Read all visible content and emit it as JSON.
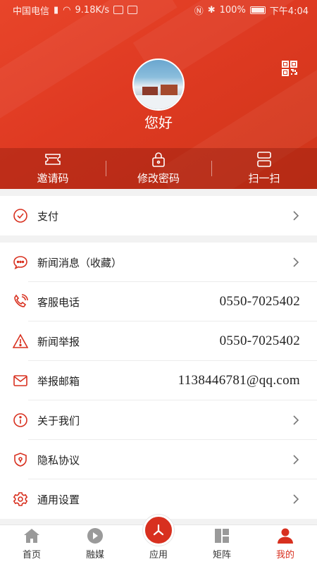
{
  "status_bar": {
    "carrier": "中国电信",
    "net_speed": "9.18K/s",
    "battery": "100%",
    "time": "下午4:04"
  },
  "profile": {
    "greeting": "您好"
  },
  "quick_actions": [
    {
      "label": "邀请码",
      "icon": "ticket-icon"
    },
    {
      "label": "修改密码",
      "icon": "lock-icon"
    },
    {
      "label": "扫一扫",
      "icon": "scan-icon"
    }
  ],
  "pay": {
    "label": "支付",
    "icon": "check-circle-icon"
  },
  "menu": [
    {
      "label": "新闻消息（收藏）",
      "icon": "message-icon",
      "value": ""
    },
    {
      "label": "客服电话",
      "icon": "phone-icon",
      "value": "0550-7025402"
    },
    {
      "label": "新闻举报",
      "icon": "warning-icon",
      "value": "0550-7025402"
    },
    {
      "label": "举报邮箱",
      "icon": "mail-icon",
      "value": "1138446781@qq.com"
    },
    {
      "label": "关于我们",
      "icon": "info-icon",
      "value": ""
    },
    {
      "label": "隐私协议",
      "icon": "shield-icon",
      "value": ""
    },
    {
      "label": "通用设置",
      "icon": "gear-icon",
      "value": ""
    }
  ],
  "tabs": [
    {
      "label": "首页",
      "icon": "home-icon"
    },
    {
      "label": "融媒",
      "icon": "play-icon"
    },
    {
      "label": "应用",
      "icon": "app-icon"
    },
    {
      "label": "矩阵",
      "icon": "grid-icon"
    },
    {
      "label": "我的",
      "icon": "user-icon"
    }
  ],
  "colors": {
    "accent": "#d8301f",
    "header": "#e4402a"
  }
}
